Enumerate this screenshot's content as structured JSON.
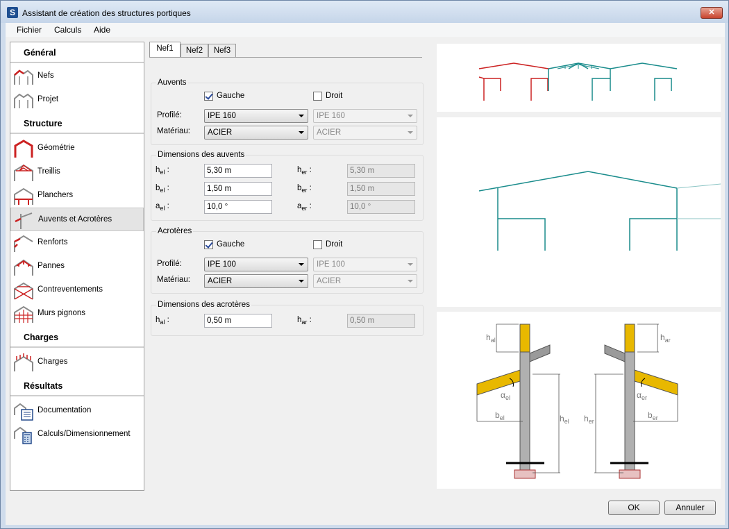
{
  "window": {
    "title": "Assistant de création des structures portiques",
    "icon_letter": "S",
    "close_symbol": "✕"
  },
  "menu": [
    "Fichier",
    "Calculs",
    "Aide"
  ],
  "nav": {
    "sections": {
      "general": "Général",
      "structure": "Structure",
      "charges": "Charges",
      "resultats": "Résultats"
    },
    "items": {
      "nefs": "Nefs",
      "projet": "Projet",
      "geometrie": "Géométrie",
      "treillis": "Treillis",
      "planchers": "Planchers",
      "auvents": "Auvents et Acrotères",
      "renforts": "Renforts",
      "pannes": "Pannes",
      "contreventements": "Contreventements",
      "murs": "Murs pignons",
      "charges": "Charges",
      "documentation": "Documentation",
      "calculs": "Calculs/Dimensionnement"
    },
    "selected": "Auvents et Acrotères"
  },
  "tabs": [
    "Nef1",
    "Nef2",
    "Nef3"
  ],
  "auvents": {
    "title": "Auvents",
    "gauche": "Gauche",
    "gauche_checked": true,
    "droit": "Droit",
    "droit_checked": false,
    "profile_label": "Profilé:",
    "materiau_label": "Matériau:",
    "left_profile": "IPE 160",
    "right_profile": "IPE 160",
    "left_material": "ACIER",
    "right_material": "ACIER"
  },
  "dim_auvents": {
    "title": "Dimensions des auvents",
    "hel": "5,30 m",
    "bel": "1,50 m",
    "ael": "10,0 °",
    "her": "5,30 m",
    "ber": "1,50 m",
    "aer": "10,0 °"
  },
  "acroteres": {
    "title": "Acrotères",
    "gauche": "Gauche",
    "gauche_checked": true,
    "droit": "Droit",
    "droit_checked": false,
    "profile_label": "Profilé:",
    "materiau_label": "Matériau:",
    "left_profile": "IPE 100",
    "right_profile": "IPE 100",
    "left_material": "ACIER",
    "right_material": "ACIER"
  },
  "dim_acroteres": {
    "title": "Dimensions des acrotères",
    "hal": "0,50 m",
    "har": "0,50 m"
  },
  "symbols": {
    "h": "h",
    "b": "b",
    "a": "a",
    "alpha": "α",
    "el": "el",
    "er": "er",
    "al": "al",
    "ar": "ar"
  },
  "buttons": {
    "ok": "OK",
    "cancel": "Annuler"
  },
  "colors": {
    "accent_red": "#cc2222",
    "teal": "#1a8c8c",
    "yellow": "#e8b800",
    "disabled": "#e6e6e6"
  }
}
